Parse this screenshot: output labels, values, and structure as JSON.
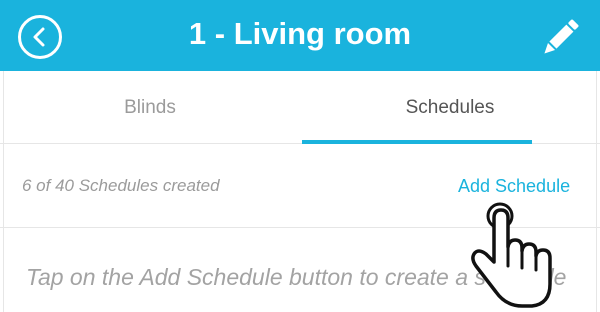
{
  "header": {
    "title": "1 - Living room",
    "back_icon": "chevron-left-icon",
    "edit_icon": "pencil-icon",
    "background": "#1ab3dd"
  },
  "tabs": [
    {
      "label": "Blinds",
      "active": false
    },
    {
      "label": "Schedules",
      "active": true
    }
  ],
  "schedules": {
    "count_text": "6 of 40 Schedules created",
    "add_label": "Add Schedule",
    "empty_hint": "Tap on the Add Schedule button to create a schedule"
  },
  "pointer_icon": "hand-pointer-icon",
  "colors": {
    "accent": "#1ab3dd",
    "muted_text": "#9b9b9b"
  }
}
